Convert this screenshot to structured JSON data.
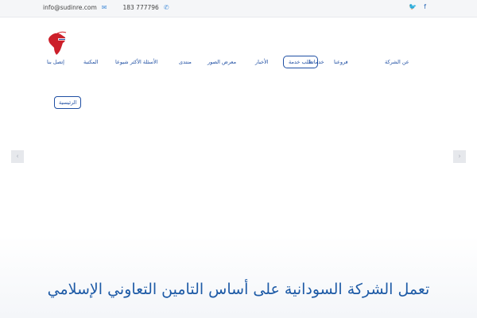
{
  "topbar": {
    "email": "info@sudinre.com",
    "phone": "183 777796",
    "email_icon": "envelope-icon",
    "phone_icon": "phone-icon",
    "social": [
      {
        "name": "twitter-icon",
        "glyph": "🐦"
      },
      {
        "name": "facebook-icon",
        "glyph": "f"
      }
    ]
  },
  "nav": {
    "items": [
      {
        "label": "عن الشركة"
      },
      {
        "label": "فروعنا"
      },
      {
        "label": "خدماتنا"
      },
      {
        "label": "طلب خدمة",
        "active": true
      },
      {
        "label": "الأخبار"
      },
      {
        "label": "معرض الصور"
      },
      {
        "label": "منتدى"
      },
      {
        "label": "الأسئلة الأكثر شيوعا"
      },
      {
        "label": "المكتبة"
      },
      {
        "label": "إتصل بنا"
      }
    ]
  },
  "breadcrumb": {
    "label": "الرئيسية"
  },
  "slider": {
    "prev_glyph": "‹",
    "next_glyph": "›",
    "headline": "تعمل الشركة السودانية على أساس التامين التعاوني الإسلامي"
  },
  "colors": {
    "accent": "#1f4fa3",
    "logo_red": "#d9232e",
    "logo_africa": "#cc1f2a"
  }
}
